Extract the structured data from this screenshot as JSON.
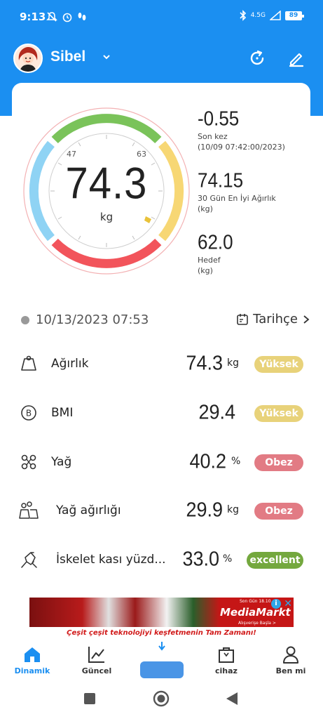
{
  "status_bar": {
    "time": "9:13",
    "battery": "89",
    "network": "4.5G"
  },
  "user": {
    "name": "Sibel"
  },
  "gauge": {
    "value": "74.3",
    "unit": "kg",
    "tick_low": "47",
    "tick_high": "63"
  },
  "stats": [
    {
      "value": "-0.55",
      "label": "Son kez",
      "sub": "(10/09 07:42:00/2023)"
    },
    {
      "value": "74.15",
      "label": "30 Gün En İyi Ağırlık",
      "sub": "(kg)"
    },
    {
      "value": "62.0",
      "label": "Hedef",
      "sub": "(kg)"
    }
  ],
  "measurement": {
    "datetime": "10/13/2023 07:53",
    "history_label": "Tarihçe"
  },
  "metrics": [
    {
      "label": "Ağırlık",
      "value": "74.3",
      "unit": "kg",
      "badge": "Yüksek",
      "badge_color": "#e8d27a"
    },
    {
      "label": "BMI",
      "value": "29.4",
      "unit": "",
      "badge": "Yüksek",
      "badge_color": "#e8d27a"
    },
    {
      "label": "Yağ",
      "value": "40.2",
      "unit": "%",
      "badge": "Obez",
      "badge_color": "#e27b84"
    },
    {
      "label": "Yağ ağırlığı",
      "value": "29.9",
      "unit": "kg",
      "badge": "Obez",
      "badge_color": "#e27b84"
    },
    {
      "label": "İskelet kası yüzd...",
      "value": "33.0",
      "unit": "%",
      "badge": "excellent",
      "badge_color": "#74a83e"
    }
  ],
  "ad": {
    "brand": "MediaMarkt",
    "corner_text": "Son Gün 18.10",
    "sub_text": "Alışverişe Başla >",
    "tagline": "Çeşit çeşit teknolojiyi keşfetmenin Tam Zamanı!",
    "info": "i",
    "close": "✕"
  },
  "nav": [
    {
      "label": "Dinamik",
      "icon": "home-icon",
      "active": true
    },
    {
      "label": "Güncel",
      "icon": "chart-icon",
      "active": false
    },
    {
      "label": "cihaz",
      "icon": "bag-icon",
      "active": false
    },
    {
      "label": "Ben mi",
      "icon": "person-icon",
      "active": false
    }
  ],
  "colors": {
    "primary": "#1b8ff1",
    "gauge_green": "#7ac35a",
    "gauge_yellow": "#f7d774",
    "gauge_red": "#f2545b",
    "gauge_blue": "#8fd3f4"
  }
}
